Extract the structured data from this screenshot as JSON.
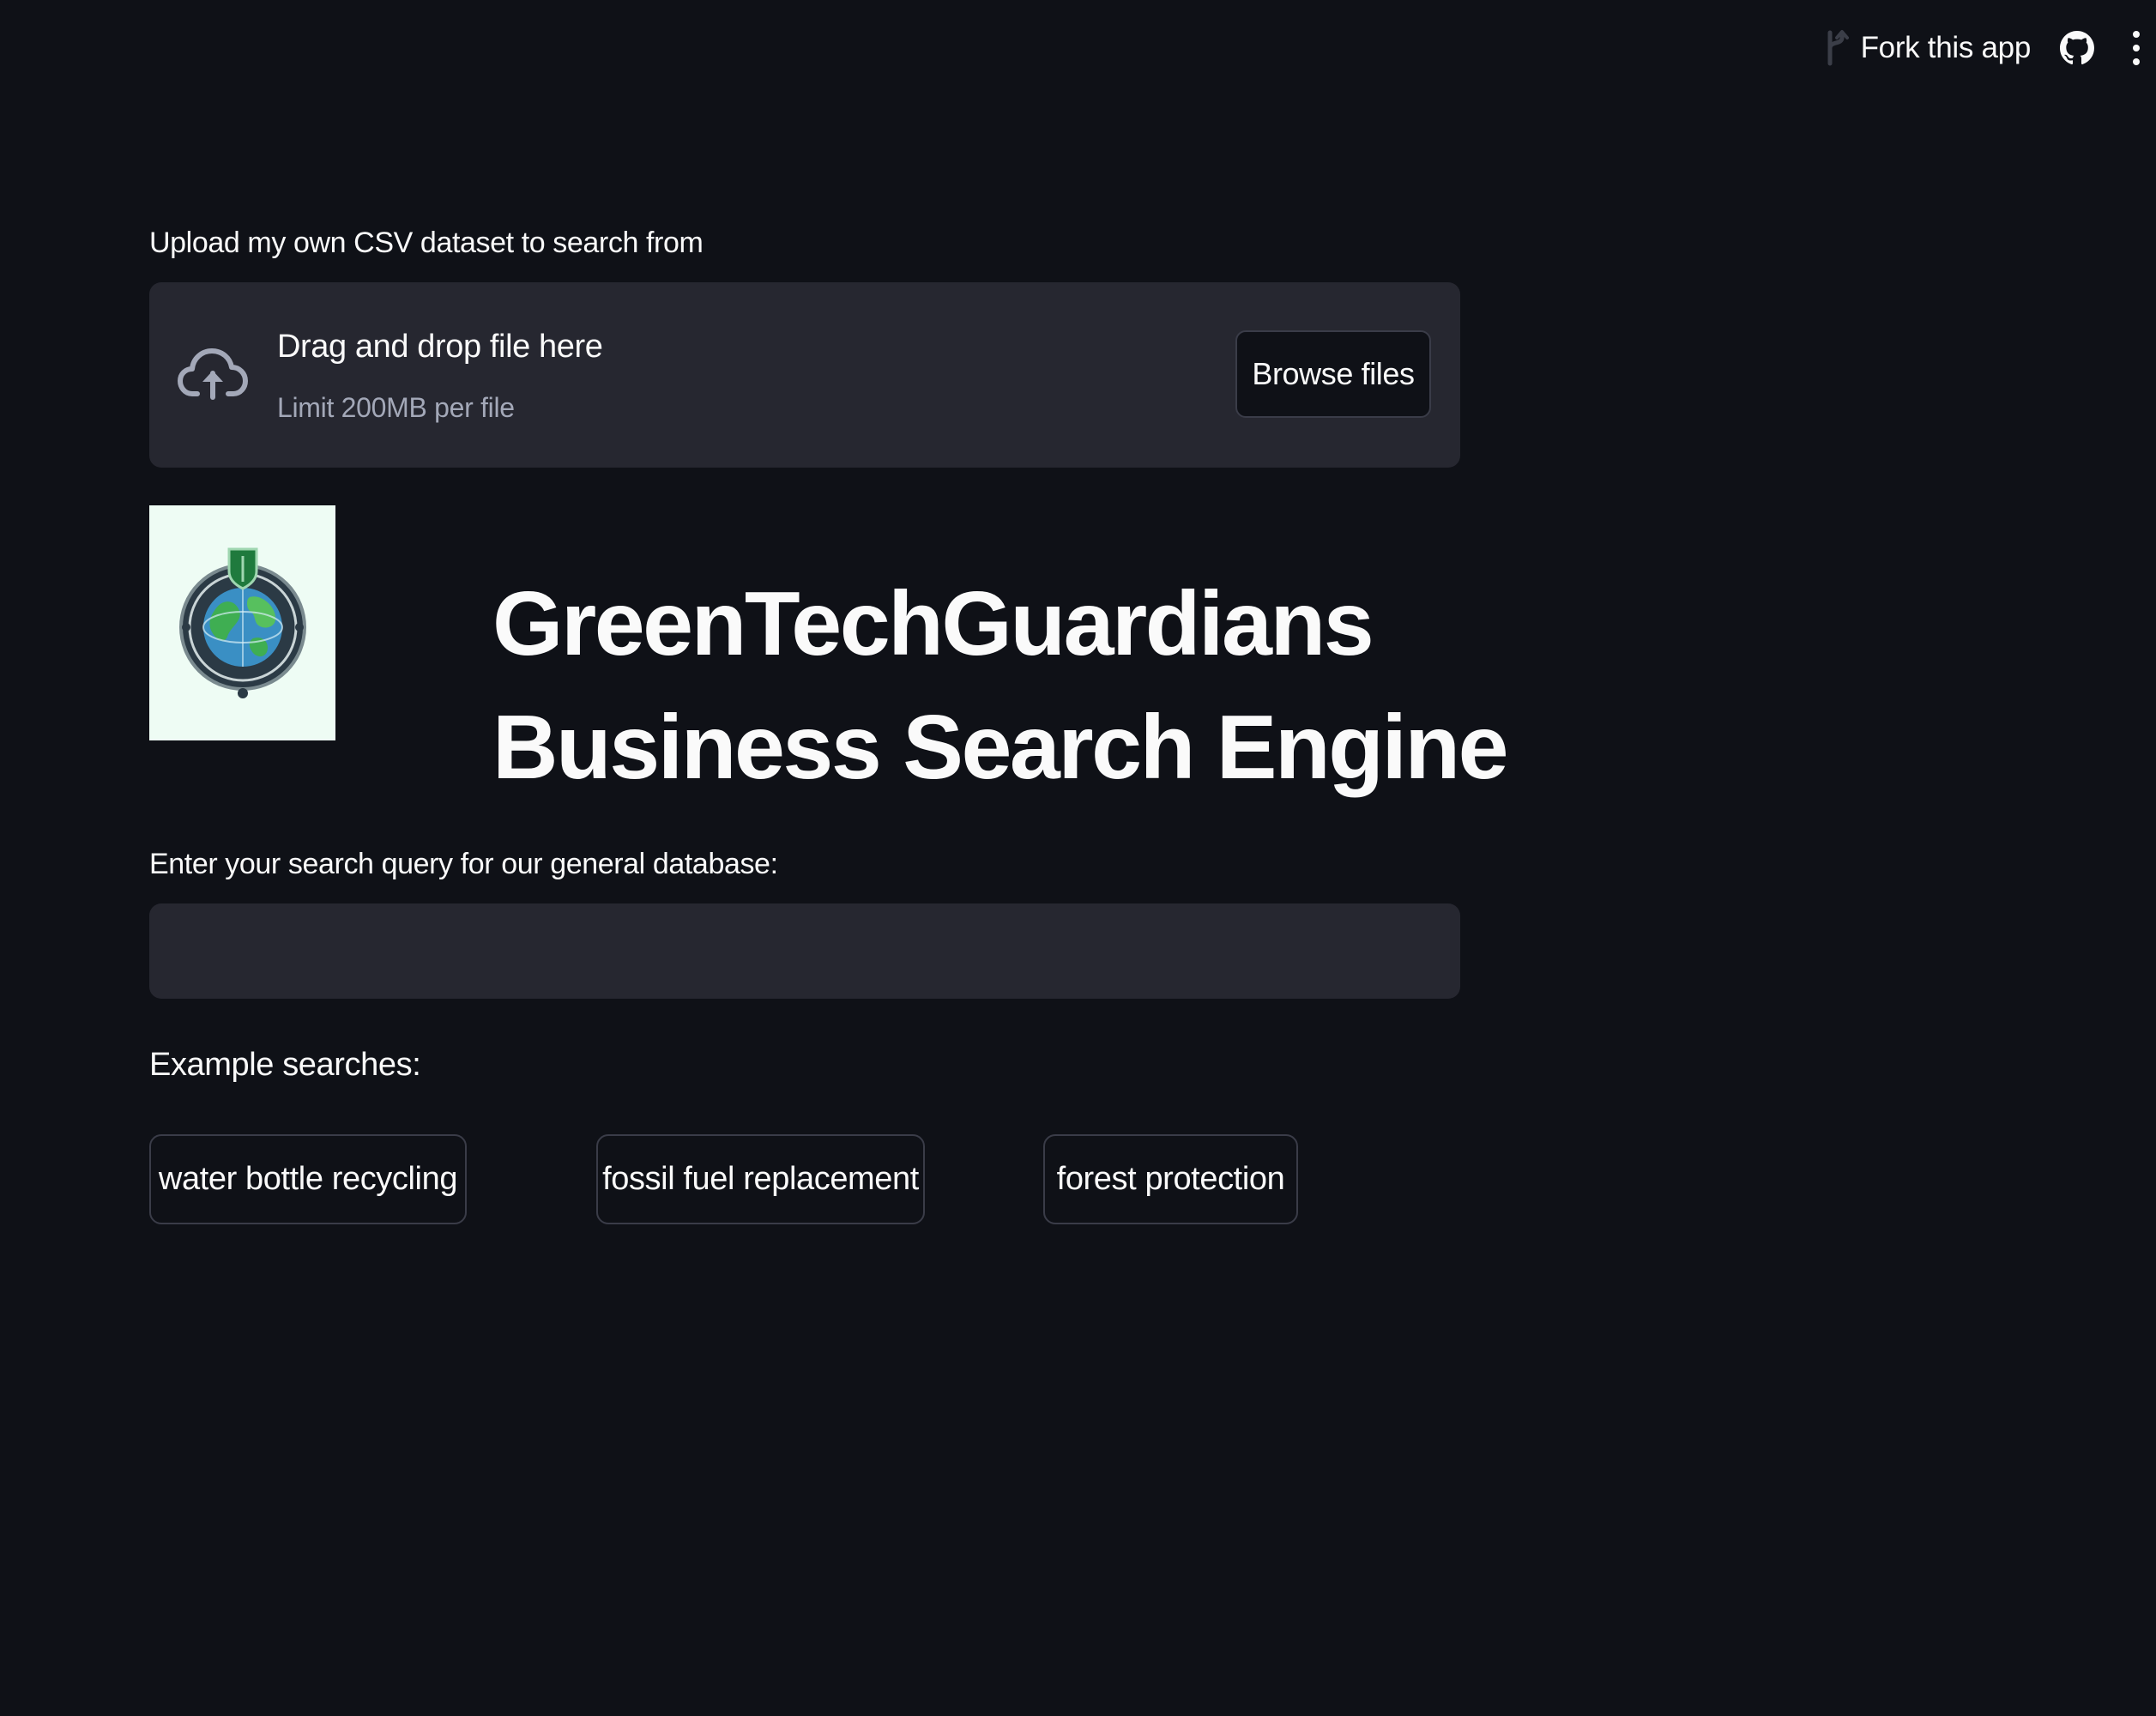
{
  "toolbar": {
    "fork_label": "Fork this app",
    "icons": [
      "fork-icon",
      "github-icon",
      "more-vertical-icon"
    ]
  },
  "uploader": {
    "label": "Upload my own CSV dataset to search from",
    "drop_title": "Drag and drop file here",
    "limit": "Limit 200MB per file",
    "browse_label": "Browse files",
    "icon": "cloud-upload-icon"
  },
  "header": {
    "logo_icon": "green-tech-guardians-logo",
    "title_line1": "GreenTechGuardians",
    "title_line2": "Business Search Engine"
  },
  "search": {
    "label": "Enter your search query for our general database:",
    "value": "",
    "placeholder": ""
  },
  "examples": {
    "label": "Example searches:",
    "items": [
      {
        "label": "water bottle recycling"
      },
      {
        "label": "fossil fuel replacement"
      },
      {
        "label": "forest protection"
      }
    ]
  },
  "colors": {
    "background": "#0f1117",
    "surface": "#262730",
    "border": "#3a3c48",
    "text": "#fafafa",
    "muted_text": "#a3a8b8"
  }
}
